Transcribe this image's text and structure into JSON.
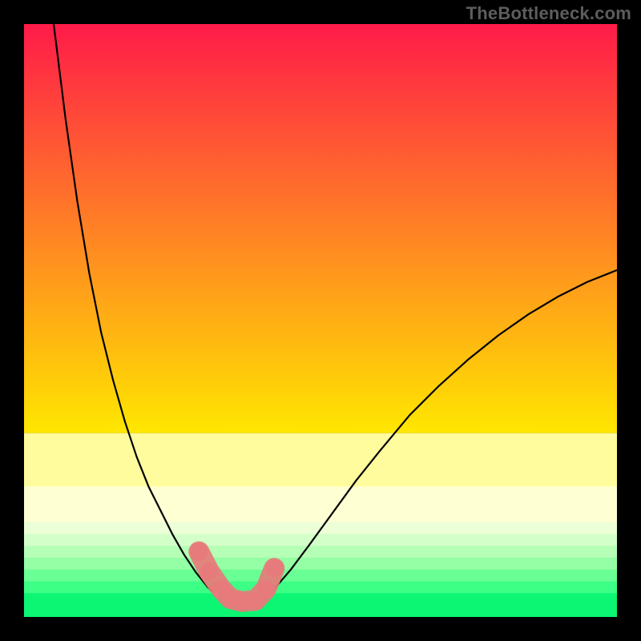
{
  "watermark": "TheBottleneck.com",
  "chart_data": {
    "type": "line",
    "title": "",
    "xlabel": "",
    "ylabel": "",
    "xlim": [
      0,
      100
    ],
    "ylim": [
      0,
      100
    ],
    "grid": false,
    "legend": false,
    "background_gradient_bands": [
      {
        "y0": 0,
        "y1": 69,
        "type": "linear",
        "from": "#ff1b49",
        "to": "#ffe700"
      },
      {
        "y0": 69,
        "y1": 78,
        "color": "#fffc9e"
      },
      {
        "y0": 78,
        "y1": 84,
        "color": "#feffd2"
      },
      {
        "y0": 84,
        "y1": 86,
        "color": "#ecffd7"
      },
      {
        "y0": 86,
        "y1": 88,
        "color": "#d3ffc8"
      },
      {
        "y0": 88,
        "y1": 90,
        "color": "#b6ffb6"
      },
      {
        "y0": 90,
        "y1": 92,
        "color": "#94ffa4"
      },
      {
        "y0": 92,
        "y1": 94,
        "color": "#6aff94"
      },
      {
        "y0": 94,
        "y1": 96,
        "color": "#3dff85"
      },
      {
        "y0": 96,
        "y1": 100,
        "color": "#0cf673"
      }
    ],
    "series": [
      {
        "name": "curve-left",
        "stroke": "#000000",
        "stroke_width": 2.2,
        "x": [
          5,
          7,
          9,
          11,
          13,
          15,
          17,
          19,
          21,
          23,
          25,
          27,
          29,
          31,
          32.5,
          34
        ],
        "y": [
          0,
          16,
          30,
          42,
          52,
          60,
          67,
          73,
          78,
          82,
          86,
          89.5,
          92.5,
          95,
          96.3,
          97.2
        ]
      },
      {
        "name": "curve-right",
        "stroke": "#000000",
        "stroke_width": 2.2,
        "x": [
          40,
          42,
          45,
          48,
          52,
          56,
          60,
          65,
          70,
          75,
          80,
          85,
          90,
          95,
          100
        ],
        "y": [
          97.2,
          95.5,
          92,
          88,
          82.5,
          77,
          72,
          66,
          61,
          56.5,
          52.5,
          49,
          46,
          43.5,
          41.5
        ]
      },
      {
        "name": "highlight-dots",
        "type": "scatter",
        "marker_color": "#e77b7b",
        "marker_size": 18,
        "x": [
          29.5,
          31.2,
          33.2,
          34.8,
          36.8,
          39.0,
          40.8,
          42.2
        ],
        "y": [
          89.0,
          92.3,
          95.2,
          96.9,
          97.4,
          97.2,
          95.3,
          91.8
        ]
      }
    ],
    "annotations": []
  }
}
